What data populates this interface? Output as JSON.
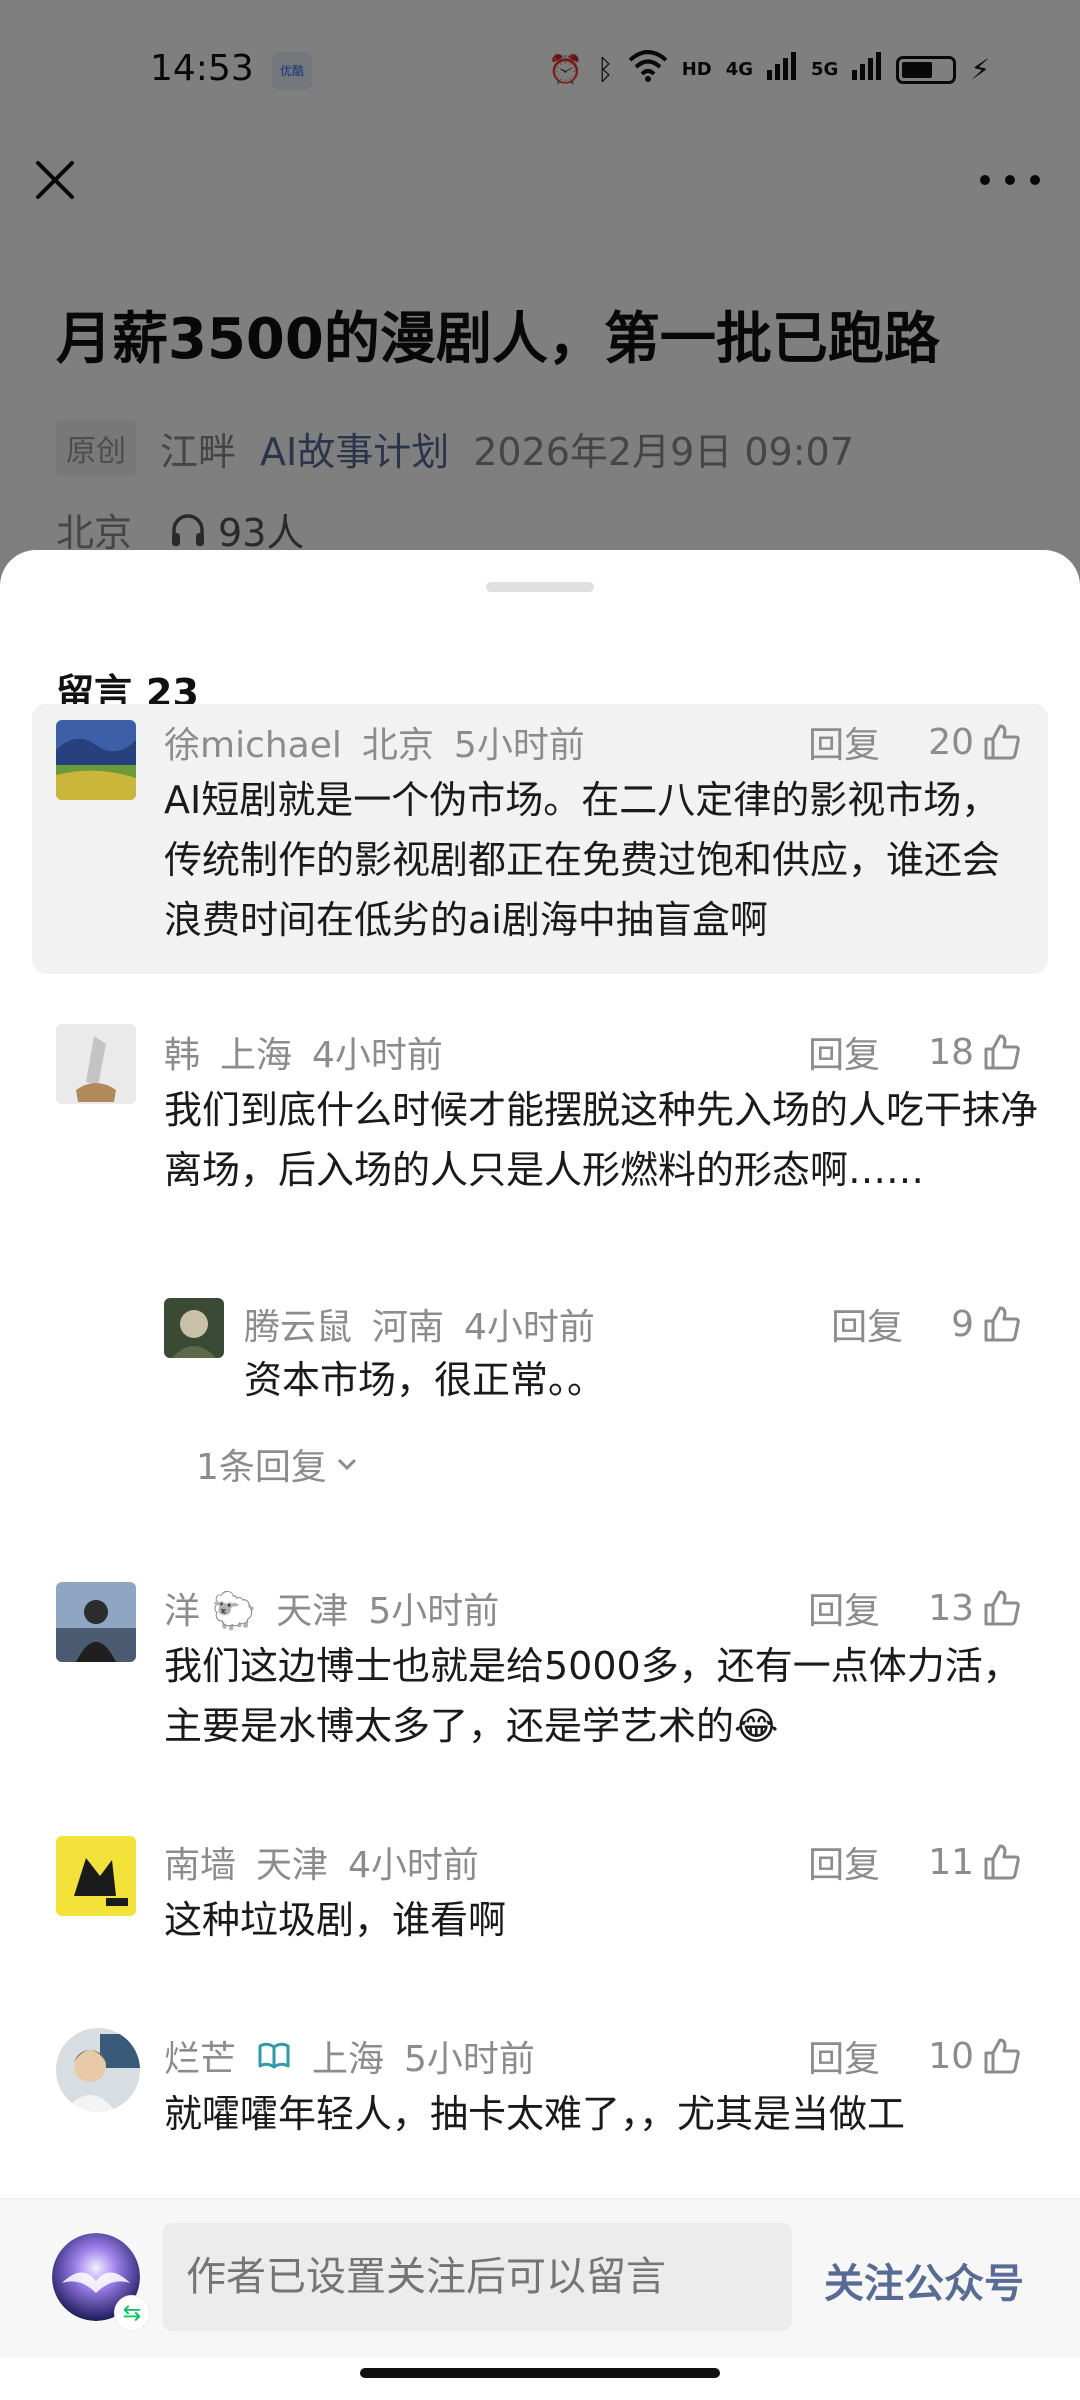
{
  "status_bar": {
    "time": "14:53",
    "app_badge": "优酷",
    "net_label_1": "HD",
    "net_label_2": "4G",
    "net_label_3": "5G"
  },
  "article": {
    "title": "月薪3500的漫剧人，第一批已跑路",
    "tag": "原创",
    "author": "江畔",
    "account": "AI故事计划",
    "datetime": "2026年2月9日 09:07",
    "location": "北京",
    "listeners": "93人"
  },
  "comments_sheet": {
    "title": "留言",
    "count": "23",
    "reply_label": "回复",
    "comments": [
      {
        "name": "徐michael",
        "location": "北京",
        "time": "5小时前",
        "likes": "20",
        "text": "AI短剧就是一个伪市场。在二八定律的影视市场，传统制作的影视剧都正在免费过饱和供应，谁还会浪费时间在低劣的ai剧海中抽盲盒啊"
      },
      {
        "name": "韩",
        "location": "上海",
        "time": "4小时前",
        "likes": "18",
        "text": "我们到底什么时候才能摆脱这种先入场的人吃干抹净离场，后入场的人只是人形燃料的形态啊……",
        "reply": {
          "name": "腾云鼠",
          "location": "河南",
          "time": "4小时前",
          "likes": "9",
          "text": "资本市场，很正常。。"
        },
        "more_replies": "1条回复"
      },
      {
        "name": "洋",
        "location": "天津",
        "time": "5小时前",
        "likes": "13",
        "text": "我们这边博士也就是给5000多，还有一点体力活，主要是水博太多了，还是学艺术的😂"
      },
      {
        "name": "南墙",
        "location": "天津",
        "time": "4小时前",
        "likes": "11",
        "text": "这种垃圾剧，谁看啊"
      },
      {
        "name": "烂芒",
        "location": "上海",
        "time": "5小时前",
        "likes": "10",
        "text": "就嚯嚯年轻人，抽卡太难了，，尤其是当做工"
      }
    ]
  },
  "input_bar": {
    "placeholder": "作者已设置关注后可以留言",
    "follow_label": "关注公众号"
  },
  "colors": {
    "link_blue": "#576b95",
    "text_gray": "#8c8c8c",
    "highlight_bg": "#f2f2f2"
  }
}
